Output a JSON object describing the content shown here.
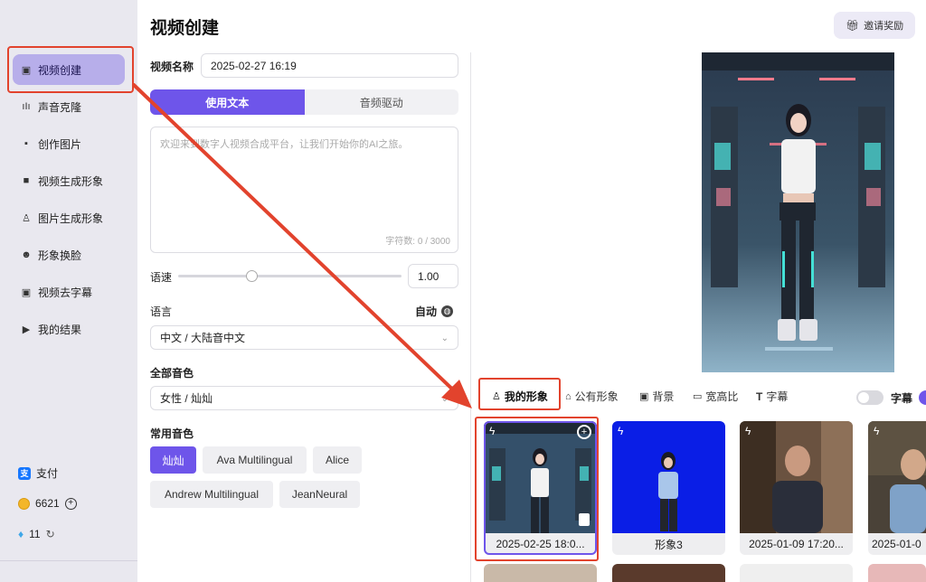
{
  "sidebar": {
    "items": [
      {
        "label": "视频创建",
        "icon": "video-plus-icon"
      },
      {
        "label": "声音克隆",
        "icon": "sound-wave-icon"
      },
      {
        "label": "创作图片",
        "icon": "image-icon"
      },
      {
        "label": "视频生成形象",
        "icon": "video-person-icon"
      },
      {
        "label": "图片生成形象",
        "icon": "image-person-icon"
      },
      {
        "label": "形象换脸",
        "icon": "face-swap-icon"
      },
      {
        "label": "视频去字幕",
        "icon": "subtitle-remove-icon"
      },
      {
        "label": "我的结果",
        "icon": "results-icon"
      }
    ],
    "pay_label": "支付",
    "coins": "6621",
    "diamonds": "11"
  },
  "header": {
    "title": "视频创建",
    "invite_label": "邀请奖励"
  },
  "form": {
    "name_label": "视频名称",
    "name_value": "2025-02-27 16:19",
    "tabs": [
      "使用文本",
      "音频驱动"
    ],
    "text_placeholder": "欢迎来到数字人视频合成平台，让我们开始你的AI之旅。",
    "char_count": "字符数: 0 / 3000",
    "speed_label": "语速",
    "speed_value": "1.00",
    "speed_fraction": 0.33,
    "language_label": "语言",
    "auto_label": "自动",
    "language_value": "中文 / 大陆音中文",
    "all_voices_label": "全部音色",
    "voice_value": "女性 / 灿灿",
    "common_voices_label": "常用音色",
    "common_voices": [
      "灿灿",
      "Ava Multilingual",
      "Alice",
      "Andrew Multilingual",
      "JeanNeural"
    ]
  },
  "avatar_tabs": {
    "items": [
      "我的形象",
      "公有形象",
      "背景",
      "宽高比",
      "字幕"
    ],
    "subtitle_toggle_label": "字幕"
  },
  "cards": [
    {
      "caption": "2025-02-25 18:0..."
    },
    {
      "caption": "形象3"
    },
    {
      "caption": "2025-01-09 17:20..."
    },
    {
      "caption": "2025-01-0"
    }
  ],
  "colors": {
    "accent": "#6e55ea",
    "annotation": "#e2432d",
    "sidebar_bg": "#e9e8ef"
  }
}
